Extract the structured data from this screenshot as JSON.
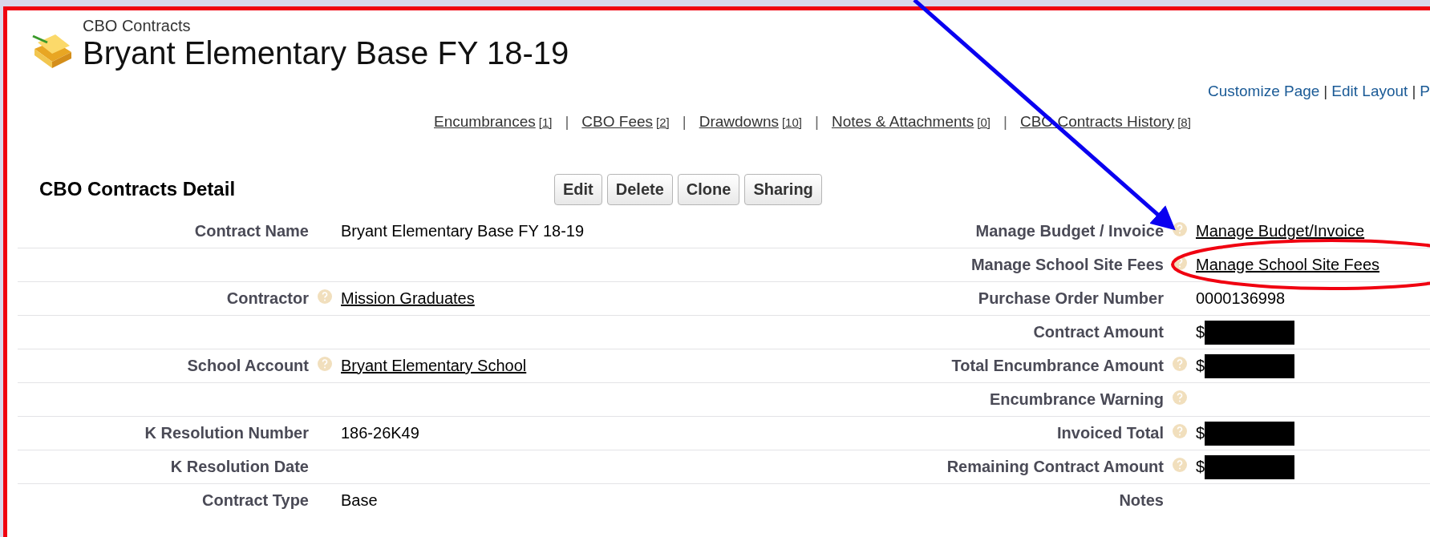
{
  "header": {
    "object_type": "CBO Contracts",
    "title": "Bryant Elementary Base FY 18-19"
  },
  "top_links": [
    {
      "kind": "link",
      "label": "Customize Page"
    },
    {
      "kind": "separator",
      "label": "|"
    },
    {
      "kind": "link",
      "label": "Edit Layout"
    },
    {
      "kind": "separator",
      "label": "|"
    },
    {
      "kind": "link",
      "label": "P"
    }
  ],
  "related_lists": [
    {
      "kind": "link",
      "label": "Encumbrances",
      "count": "[1]"
    },
    {
      "kind": "separator",
      "label": "|"
    },
    {
      "kind": "link",
      "label": "CBO Fees",
      "count": "[2]"
    },
    {
      "kind": "separator",
      "label": "|"
    },
    {
      "kind": "link",
      "label": "Drawdowns",
      "count": "[10]"
    },
    {
      "kind": "separator",
      "label": "|"
    },
    {
      "kind": "link",
      "label": "Notes & Attachments",
      "count": "[0]"
    },
    {
      "kind": "separator",
      "label": "|"
    },
    {
      "kind": "link",
      "label": "CBO Contracts History",
      "count": "[8]"
    }
  ],
  "detail": {
    "title": "CBO Contracts Detail",
    "buttons": [
      "Edit",
      "Delete",
      "Clone",
      "Sharing"
    ],
    "rows": [
      {
        "left": {
          "label": "Contract Name",
          "help": false,
          "kind": "text",
          "value": "Bryant Elementary Base FY 18-19"
        },
        "right": {
          "label": "Manage Budget / Invoice",
          "help": true,
          "kind": "link",
          "value": "Manage Budget/Invoice"
        }
      },
      {
        "right": {
          "label": "Manage School Site Fees",
          "help": true,
          "kind": "link",
          "value": "Manage School Site Fees"
        }
      },
      {
        "left": {
          "label": "Contractor",
          "help": true,
          "kind": "link",
          "value": "Mission Graduates"
        },
        "right": {
          "label": "Purchase Order Number",
          "help": false,
          "kind": "text",
          "value": "0000136998"
        }
      },
      {
        "right": {
          "label": "Contract Amount",
          "help": false,
          "kind": "redacted",
          "value": "$"
        }
      },
      {
        "left": {
          "label": "School Account",
          "help": true,
          "kind": "link",
          "value": "Bryant Elementary School"
        },
        "right": {
          "label": "Total Encumbrance Amount",
          "help": true,
          "kind": "redacted",
          "value": "$"
        }
      },
      {
        "right": {
          "label": "Encumbrance Warning",
          "help": true,
          "kind": "text"
        }
      },
      {
        "left": {
          "label": "K Resolution Number",
          "help": false,
          "kind": "text",
          "value": "186-26K49"
        },
        "right": {
          "label": "Invoiced Total",
          "help": true,
          "kind": "redacted",
          "value": "$"
        }
      },
      {
        "left": {
          "label": "K Resolution Date",
          "help": false,
          "kind": "text"
        },
        "right": {
          "label": "Remaining Contract Amount",
          "help": true,
          "kind": "redacted",
          "value": "$"
        }
      },
      {
        "left": {
          "label": "Contract Type",
          "help": false,
          "kind": "text",
          "value": "Base"
        },
        "right": {
          "label": "Notes",
          "help": false,
          "kind": "text"
        }
      }
    ]
  }
}
